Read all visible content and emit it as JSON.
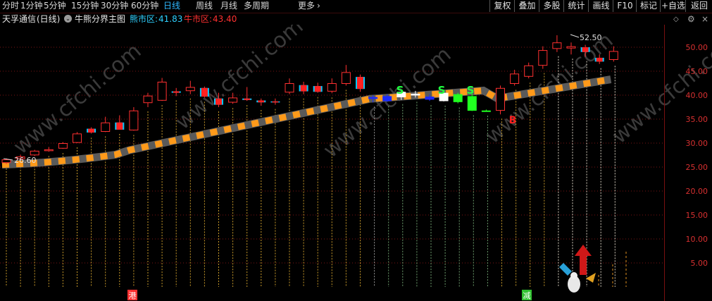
{
  "toolbar": {
    "periods": [
      "分时",
      "1分钟",
      "5分钟",
      "15分钟",
      "30分钟",
      "60分钟",
      "日线",
      "周线",
      "月线",
      "多周期",
      "更多"
    ],
    "active_period": "日线",
    "more_icon": "chevron-right-icon",
    "buttons": [
      "复权",
      "叠加",
      "多股",
      "统计",
      "画线",
      "F10",
      "标记",
      "+自选",
      "返回"
    ]
  },
  "info": {
    "stock_name": "天孚通信",
    "period_tag": "(日线)",
    "indicator_icon": "chevron-down-circle-icon",
    "indicator_name": "牛熊分界主图",
    "bear_label": "熊市区:",
    "bear_value": "41.83",
    "bull_label": "牛市区:",
    "bull_value": "43.40",
    "colors": {
      "bear": "#2fd0ff",
      "bull": "#ff3030"
    }
  },
  "watermark": "www.cfchi.com",
  "chart_data": {
    "type": "candlestick",
    "y_axis": {
      "ticks": [
        50.0,
        45.0,
        40.0,
        35.0,
        30.0,
        25.0,
        20.0,
        15.0,
        10.0,
        5.0
      ],
      "range": [
        0,
        54
      ]
    },
    "annotations": {
      "high_label": "52.50",
      "low_label": "26.60",
      "buy_signal": "B",
      "sell_signal": "S"
    },
    "x_markers": [
      {
        "text": "港",
        "color": "#ff3030"
      },
      {
        "text": "减",
        "color": "#30c030"
      }
    ],
    "candles": [
      {
        "o": 26.0,
        "h": 26.8,
        "l": 25.6,
        "c": 26.6,
        "col": "red"
      },
      {
        "o": 26.8,
        "h": 27.6,
        "l": 26.5,
        "c": 27.2,
        "col": "red"
      },
      {
        "o": 27.6,
        "h": 28.6,
        "l": 27.3,
        "c": 28.4,
        "col": "red"
      },
      {
        "o": 28.5,
        "h": 29.2,
        "l": 28.2,
        "c": 28.7,
        "col": "red"
      },
      {
        "o": 29.0,
        "h": 30.2,
        "l": 28.8,
        "c": 30.0,
        "col": "red"
      },
      {
        "o": 30.2,
        "h": 32.3,
        "l": 30.0,
        "c": 32.0,
        "col": "red"
      },
      {
        "o": 32.2,
        "h": 33.3,
        "l": 32.0,
        "c": 33.0,
        "col": "redfill"
      },
      {
        "o": 32.5,
        "h": 35.5,
        "l": 32.3,
        "c": 34.3,
        "col": "red"
      },
      {
        "o": 34.3,
        "h": 35.8,
        "l": 32.8,
        "c": 32.8,
        "col": "redfill"
      },
      {
        "o": 32.8,
        "h": 37.5,
        "l": 32.6,
        "c": 36.8,
        "col": "red"
      },
      {
        "o": 38.5,
        "h": 40.5,
        "l": 37.5,
        "c": 39.9,
        "col": "red"
      },
      {
        "o": 39.0,
        "h": 43.6,
        "l": 38.8,
        "c": 42.8,
        "col": "red"
      },
      {
        "o": 40.5,
        "h": 41.5,
        "l": 39.8,
        "c": 40.8,
        "col": "redfill"
      },
      {
        "o": 41.0,
        "h": 43.0,
        "l": 40.2,
        "c": 41.7,
        "col": "red"
      },
      {
        "o": 41.5,
        "h": 41.8,
        "l": 39.5,
        "c": 39.7,
        "col": "redfill"
      },
      {
        "o": 39.3,
        "h": 40.5,
        "l": 37.5,
        "c": 38.0,
        "col": "redfill"
      },
      {
        "o": 38.6,
        "h": 40.5,
        "l": 38.2,
        "c": 39.5,
        "col": "red"
      },
      {
        "o": 39.3,
        "h": 41.7,
        "l": 38.8,
        "c": 39.0,
        "col": "redfill"
      },
      {
        "o": 38.9,
        "h": 39.3,
        "l": 37.8,
        "c": 38.5,
        "col": "redfill"
      },
      {
        "o": 38.6,
        "h": 39.3,
        "l": 38.0,
        "c": 38.7,
        "col": "redfill"
      },
      {
        "o": 40.7,
        "h": 43.5,
        "l": 40.2,
        "c": 42.5,
        "col": "red"
      },
      {
        "o": 40.8,
        "h": 42.8,
        "l": 40.2,
        "c": 42.1,
        "col": "redfill"
      },
      {
        "o": 41.9,
        "h": 42.6,
        "l": 40.5,
        "c": 40.7,
        "col": "redfill"
      },
      {
        "o": 40.9,
        "h": 43.5,
        "l": 40.4,
        "c": 42.5,
        "col": "red"
      },
      {
        "o": 42.5,
        "h": 46.3,
        "l": 42.0,
        "c": 44.8,
        "col": "red"
      },
      {
        "o": 43.8,
        "h": 44.3,
        "l": 40.7,
        "c": 41.3,
        "col": "redfill"
      },
      {
        "o": 39.5,
        "h": 40.0,
        "l": 38.5,
        "c": 39.6,
        "col": "blue"
      },
      {
        "o": 39.8,
        "h": 40.2,
        "l": 38.6,
        "c": 38.9,
        "col": "blue"
      },
      {
        "o": 39.7,
        "h": 40.8,
        "l": 39.0,
        "c": 40.7,
        "col": "white"
      },
      {
        "o": 40.3,
        "h": 40.9,
        "l": 39.5,
        "c": 40.2,
        "col": "white"
      },
      {
        "o": 39.7,
        "h": 40.2,
        "l": 38.8,
        "c": 39.2,
        "col": "blue"
      },
      {
        "o": 40.5,
        "h": 41.1,
        "l": 38.7,
        "c": 38.9,
        "col": "white"
      },
      {
        "o": 38.7,
        "h": 40.5,
        "l": 38.3,
        "c": 40.2,
        "col": "green"
      },
      {
        "o": 39.8,
        "h": 40.3,
        "l": 36.7,
        "c": 36.9,
        "col": "green"
      },
      {
        "o": 36.8,
        "h": 37.0,
        "l": 36.6,
        "c": 36.8,
        "col": "greenline"
      },
      {
        "o": 36.9,
        "h": 42.0,
        "l": 36.0,
        "c": 41.5,
        "col": "red"
      },
      {
        "o": 42.5,
        "h": 45.3,
        "l": 42.0,
        "c": 44.5,
        "col": "red"
      },
      {
        "o": 44.0,
        "h": 46.8,
        "l": 43.5,
        "c": 46.2,
        "col": "red"
      },
      {
        "o": 46.3,
        "h": 50.2,
        "l": 45.5,
        "c": 49.4,
        "col": "red"
      },
      {
        "o": 49.8,
        "h": 52.5,
        "l": 49.0,
        "c": 51.0,
        "col": "red"
      },
      {
        "o": 50.2,
        "h": 51.0,
        "l": 48.5,
        "c": 49.9,
        "col": "red"
      },
      {
        "o": 50.0,
        "h": 50.5,
        "l": 48.0,
        "c": 49.0,
        "col": "redfill"
      },
      {
        "o": 47.8,
        "h": 48.5,
        "l": 46.5,
        "c": 47.0,
        "col": "redfill"
      },
      {
        "o": 47.5,
        "h": 50.2,
        "l": 47.0,
        "c": 49.2,
        "col": "red"
      }
    ]
  }
}
